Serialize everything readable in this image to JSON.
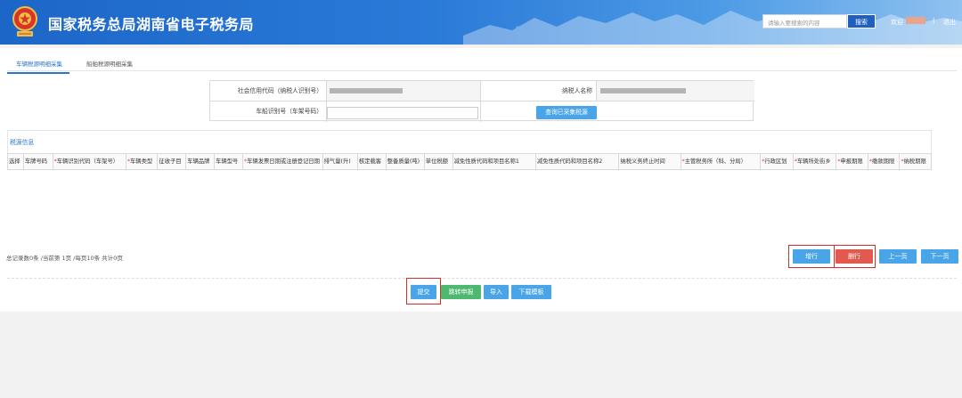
{
  "header": {
    "site_title": "国家税务总局湖南省电子税务局",
    "search_placeholder": "请输入要搜索的内容",
    "search_label": "搜索",
    "welcome": "欢迎",
    "separator": "|",
    "logout": "退出",
    "brand_color": "#1c66c7"
  },
  "tabs": [
    {
      "label": "车辆税源明细采集",
      "active": true
    },
    {
      "label": "船舶税源明细采集",
      "active": false
    }
  ],
  "query": {
    "credit_code_label": "社会信用代码（纳税人识别号）",
    "taxpayer_name_label": "纳税人名称",
    "vin_label": "车船识别号（车架号码）",
    "query_button": "查询已采集税源"
  },
  "grid": {
    "title": "税源信息",
    "columns": [
      {
        "label": "选择",
        "required": false
      },
      {
        "label": "车牌号码",
        "required": false
      },
      {
        "label": "车辆识别代码（车架号）",
        "required": true
      },
      {
        "label": "车辆类型",
        "required": true
      },
      {
        "label": "征收子目",
        "required": false
      },
      {
        "label": "车辆品牌",
        "required": false
      },
      {
        "label": "车辆型号",
        "required": false
      },
      {
        "label": "车辆发票日期或注册登记日期",
        "required": true
      },
      {
        "label": "排气量(升)",
        "required": false
      },
      {
        "label": "核定载客",
        "required": false
      },
      {
        "label": "整备质量(吨)",
        "required": false
      },
      {
        "label": "单位税额",
        "required": false
      },
      {
        "label": "减免性质代码和项目名称1",
        "required": false
      },
      {
        "label": "减免性质代码和项目名称2",
        "required": false
      },
      {
        "label": "纳税义务终止时间",
        "required": false
      },
      {
        "label": "主管税务所（科、分局）",
        "required": true
      },
      {
        "label": "行政区划",
        "required": true
      },
      {
        "label": "车辆所处街乡",
        "required": true
      },
      {
        "label": "申报期限",
        "required": true
      },
      {
        "label": "缴款期限",
        "required": true
      },
      {
        "label": "纳税期限",
        "required": true
      }
    ]
  },
  "pagination": {
    "summary": "总记录数0条 /当前第 1页 /每页10条 共计0页",
    "add_row": "增行",
    "delete_row": "删行",
    "prev_page": "上一页",
    "next_page": "下一页"
  },
  "actions": {
    "submit": "提交",
    "goto_declare": "跳转申报",
    "import": "导入",
    "download_template": "下载模板"
  }
}
